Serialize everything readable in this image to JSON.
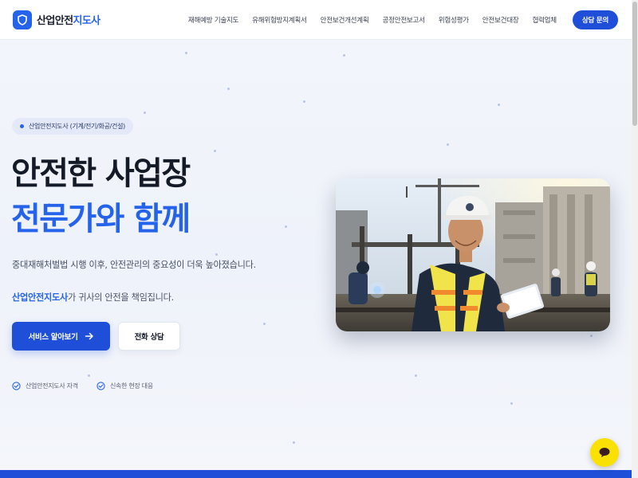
{
  "header": {
    "logo_part1": "산업안전",
    "logo_part2": "지도사",
    "nav": [
      {
        "label": "재해예방 기술지도"
      },
      {
        "label": "유해위험방지계획서"
      },
      {
        "label": "안전보건개선계획"
      },
      {
        "label": "공정안전보고서"
      },
      {
        "label": "위험성평가"
      },
      {
        "label": "안전보건대장"
      },
      {
        "label": "협력업체"
      }
    ],
    "cta_label": "상담 문의"
  },
  "hero": {
    "badge": "산업안전지도사 (기계/전기/화공/건설)",
    "title_line1": "안전한 사업장",
    "title_line2": "전문가와 함께",
    "desc_line1": "중대재해처벌법 시행 이후, 안전관리의 중요성이 더욱 높아졌습니다.",
    "desc_highlight": "산업안전지도사",
    "desc_line2_rest": "가 귀사의 안전을 책임집니다.",
    "primary_button": "서비스 알아보기",
    "secondary_button": "전화 상담",
    "checks": [
      {
        "label": "산업안전지도사 자격"
      },
      {
        "label": "신속한 현장 대응"
      }
    ]
  },
  "colors": {
    "accent": "#2563eb",
    "button": "#1f4fd8",
    "chat": "#fae100"
  }
}
